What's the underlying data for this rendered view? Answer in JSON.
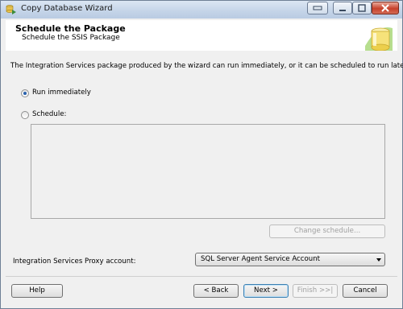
{
  "window": {
    "title": "Copy Database Wizard"
  },
  "header": {
    "title": "Schedule the Package",
    "subtitle": "Schedule the SSIS Package"
  },
  "content": {
    "description": "The Integration Services package produced by the wizard can run immediately, or it can be scheduled to run later.",
    "run_immediately_label": "Run immediately",
    "run_immediately_selected": true,
    "schedule_label": "Schedule:",
    "schedule_selected": false,
    "change_schedule_label": "Change schedule...",
    "proxy_label": "Integration Services Proxy account:",
    "proxy_value": "SQL Server Agent Service Account"
  },
  "footer": {
    "help_label": "Help",
    "back_label": "< Back",
    "next_label": "Next >",
    "finish_label": "Finish >>|",
    "cancel_label": "Cancel"
  },
  "icons": [
    "app-icon",
    "minimize-icon",
    "maximize-icon",
    "close-icon",
    "database-icon"
  ],
  "colors": {
    "accent": "#2a62ad",
    "titlebar": "#c4d4e8",
    "close_button": "#c7412b"
  }
}
